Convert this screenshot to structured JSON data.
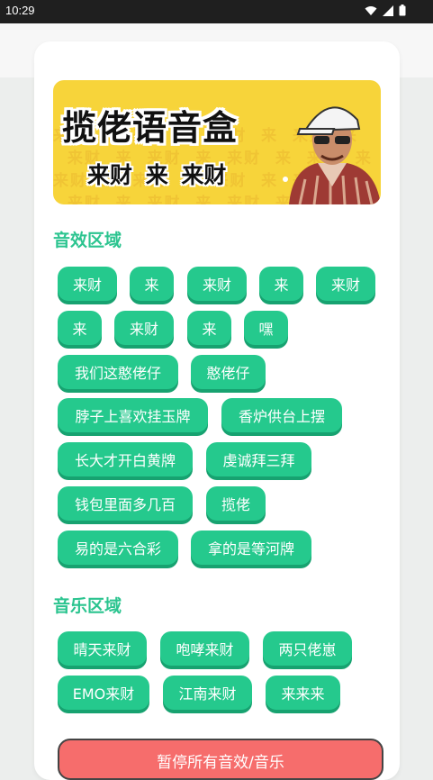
{
  "status_bar": {
    "time": "10:29",
    "icons": [
      "wifi-icon",
      "signal-icon",
      "battery-icon"
    ]
  },
  "banner": {
    "title": "揽佬语音盒",
    "subtitle": "来财 来 来财",
    "pattern_text": "来财"
  },
  "sound_section": {
    "title": "音效区域",
    "buttons": [
      "来财",
      "来",
      "来财",
      "来",
      "来财",
      "来",
      "来财",
      "来",
      "嘿",
      "我们这憨佬仔",
      "憨佬仔",
      "脖子上喜欢挂玉牌",
      "香炉供台上摆",
      "长大才开白黄牌",
      "虔诚拜三拜",
      "钱包里面多几百",
      "揽佬",
      "易的是六合彩",
      "拿的是等河牌"
    ]
  },
  "music_section": {
    "title": "音乐区域",
    "buttons": [
      "晴天来财",
      "咆哮来财",
      "两只佬崽",
      "EMO来财",
      "江南来财",
      "来来来"
    ]
  },
  "stop_button": {
    "label": "暂停所有音效/音乐"
  },
  "colors": {
    "accent_green": "#25c98d",
    "section_title_green": "#2bc48f",
    "stop_red": "#f66d6c",
    "banner_yellow": "#f7d43a"
  }
}
